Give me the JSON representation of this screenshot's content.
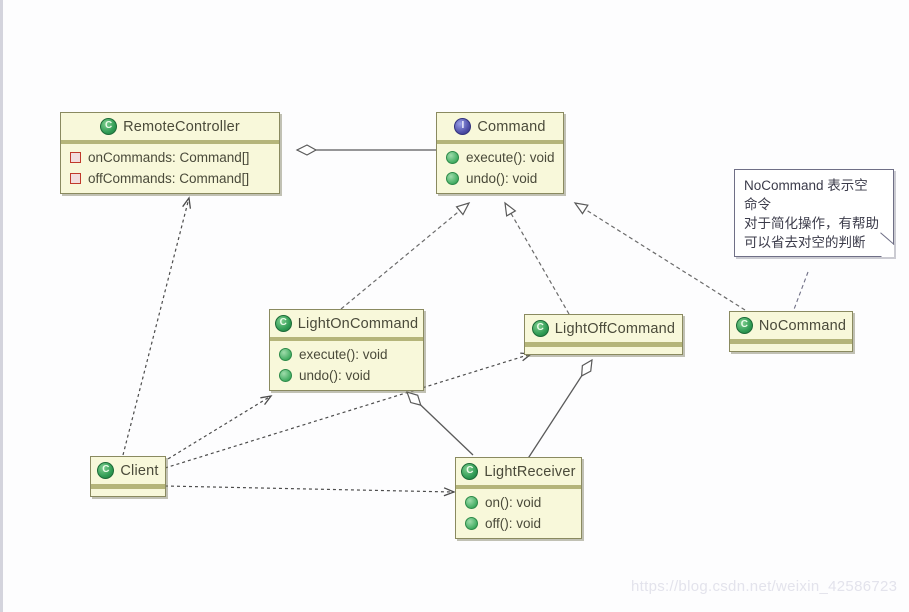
{
  "diagram": {
    "title": "Command Pattern UML Class Diagram",
    "background": "#fdfdfe",
    "box_fill": "#f8f8da",
    "box_border": "#8a8a60",
    "header_rule": "#b5b57a"
  },
  "classes": [
    {
      "id": "remote-controller",
      "name": "RemoteController",
      "stereotype_icon": "class-icon",
      "members": [
        {
          "icon": "field-icon",
          "text": "onCommands: Command[]"
        },
        {
          "icon": "field-icon",
          "text": "offCommands: Command[]"
        }
      ]
    },
    {
      "id": "command",
      "name": "Command",
      "stereotype_icon": "interface-icon",
      "members": [
        {
          "icon": "method-icon",
          "text": "execute(): void"
        },
        {
          "icon": "method-icon",
          "text": "undo(): void"
        }
      ]
    },
    {
      "id": "light-on-command",
      "name": "LightOnCommand",
      "stereotype_icon": "class-icon",
      "members": [
        {
          "icon": "method-icon",
          "text": "execute(): void"
        },
        {
          "icon": "method-icon",
          "text": "undo(): void"
        }
      ]
    },
    {
      "id": "light-off-command",
      "name": "LightOffCommand",
      "stereotype_icon": "class-icon",
      "members": []
    },
    {
      "id": "no-command",
      "name": "NoCommand",
      "stereotype_icon": "class-icon",
      "members": []
    },
    {
      "id": "client",
      "name": "Client",
      "stereotype_icon": "class-icon",
      "members": []
    },
    {
      "id": "light-receiver",
      "name": "LightReceiver",
      "stereotype_icon": "class-icon",
      "members": [
        {
          "icon": "method-icon",
          "text": "on(): void"
        },
        {
          "icon": "method-icon",
          "text": "off(): void"
        }
      ]
    }
  ],
  "note": {
    "id": "no-command-note",
    "lines": [
      "NoCommand 表示空",
      "命令",
      "对于简化操作，有帮助",
      "可以省去对空的判断"
    ]
  },
  "relations": [
    {
      "type": "aggregation",
      "from": "RemoteController",
      "to": "Command"
    },
    {
      "type": "realization",
      "from": "LightOnCommand",
      "to": "Command"
    },
    {
      "type": "realization",
      "from": "LightOffCommand",
      "to": "Command"
    },
    {
      "type": "realization",
      "from": "NoCommand",
      "to": "Command"
    },
    {
      "type": "aggregation",
      "from": "LightOnCommand",
      "to": "LightReceiver"
    },
    {
      "type": "aggregation",
      "from": "LightOffCommand",
      "to": "LightReceiver"
    },
    {
      "type": "dependency",
      "from": "Client",
      "to": "RemoteController"
    },
    {
      "type": "dependency",
      "from": "Client",
      "to": "LightOnCommand"
    },
    {
      "type": "dependency",
      "from": "Client",
      "to": "LightOffCommand"
    },
    {
      "type": "dependency",
      "from": "Client",
      "to": "LightReceiver"
    },
    {
      "type": "note-link",
      "from": "no-command-note",
      "to": "NoCommand"
    }
  ],
  "watermark": {
    "text": "https://blog.csdn.net/weixin_42586723"
  }
}
